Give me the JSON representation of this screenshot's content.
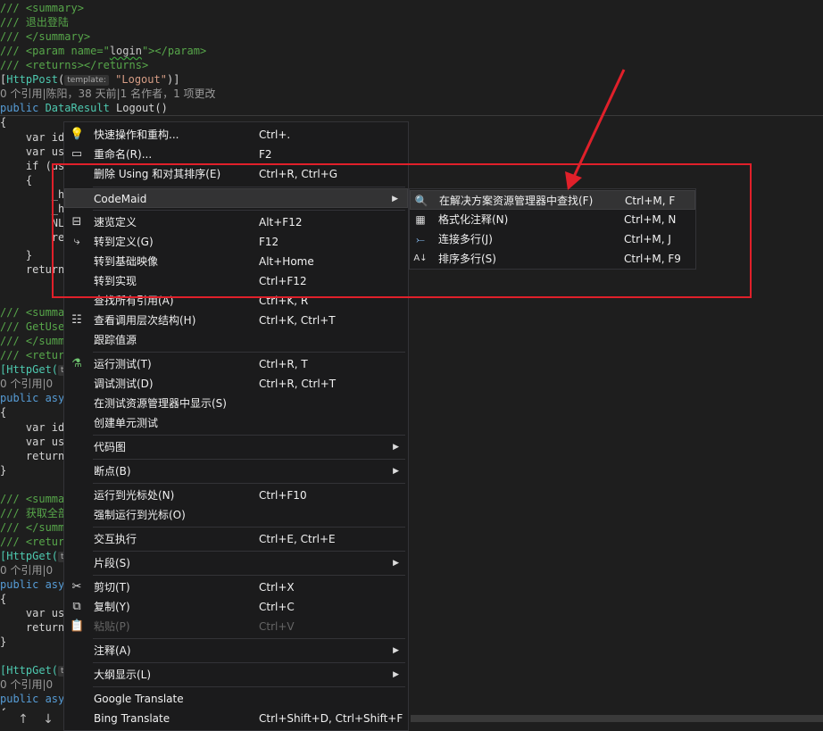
{
  "code": {
    "l1": "/// <summary>",
    "l2": "/// 退出登陆",
    "l3": "/// </summary>",
    "l4a": "/// <param name=\"",
    "l4b": "login",
    "l4c": "\"></param>",
    "l5": "/// <returns></returns>",
    "l6a": "[",
    "l6b": "HttpPost",
    "l6c": "(",
    "l6tmpl": "template:",
    "l6d": " \"Logout\"",
    "l6e": ")]",
    "lens1": "0 个引用|陈阳，38 天前|1 名作者，1 项更改",
    "l7a": "public ",
    "l7b": "DataResult",
    "l7c": " Logout()",
    "l8": "{",
    "l9": "    var id",
    "l10": "    var use",
    "l11": "    if (use",
    "l12": "    {",
    "l13": "        _ht",
    "l14": "        _ht",
    "l15": "        NLo",
    "l16": "        ret",
    "l17": "    }",
    "l18": "    return",
    "l19": "/// <summar",
    "l20": "/// GetUser",
    "l21": "/// </summa",
    "l22": "/// <retur",
    "l23a": "[HttpGet(",
    "l23tmpl": "te",
    "lens2": "0 个引用|0",
    "l24": "public asyn",
    "l25": "{",
    "l26": "    var id",
    "l27": "    var use",
    "l28": "    return",
    "l29": "}",
    "l30": "/// <summar",
    "l31": "/// 获取全部",
    "l32": "/// </summa",
    "l33": "/// <retur",
    "l34a": "[HttpGet(",
    "l34tmpl": "te",
    "lens3": "0 个引用|0",
    "l35": "public asyn",
    "l36": "{",
    "l37": "    var use",
    "l38": "    return",
    "l39": "}",
    "l40a": "[HttpGet(",
    "l40tmpl": "te",
    "lens4": "0 个引用|0",
    "l41": "public asyn",
    "l42": "{"
  },
  "context_menu": {
    "items": [
      {
        "label": "快速操作和重构...",
        "shortcut": "Ctrl+.",
        "icon": "lightbulb-icon"
      },
      {
        "label": "重命名(R)...",
        "shortcut": "F2",
        "icon": "rename-icon"
      },
      {
        "label": "删除 Using 和对其排序(E)",
        "shortcut": "Ctrl+R, Ctrl+G"
      },
      {
        "label": "CodeMaid",
        "shortcut": ""
      },
      {
        "label": "速览定义",
        "shortcut": "Alt+F12",
        "icon": "peek-definition-icon"
      },
      {
        "label": "转到定义(G)",
        "shortcut": "F12",
        "icon": "goto-definition-icon"
      },
      {
        "label": "转到基础映像",
        "shortcut": "Alt+Home"
      },
      {
        "label": "转到实现",
        "shortcut": "Ctrl+F12"
      },
      {
        "label": "查找所有引用(A)",
        "shortcut": "Ctrl+K, R"
      },
      {
        "label": "查看调用层次结构(H)",
        "shortcut": "Ctrl+K, Ctrl+T",
        "icon": "call-hierarchy-icon"
      },
      {
        "label": "跟踪值源",
        "shortcut": ""
      },
      {
        "label": "运行测试(T)",
        "shortcut": "Ctrl+R, T",
        "icon": "run-test-icon"
      },
      {
        "label": "调试测试(D)",
        "shortcut": "Ctrl+R, Ctrl+T"
      },
      {
        "label": "在测试资源管理器中显示(S)",
        "shortcut": ""
      },
      {
        "label": "创建单元测试",
        "shortcut": ""
      },
      {
        "label": "代码图",
        "shortcut": ""
      },
      {
        "label": "断点(B)",
        "shortcut": ""
      },
      {
        "label": "运行到光标处(N)",
        "shortcut": "Ctrl+F10"
      },
      {
        "label": "强制运行到光标(O)",
        "shortcut": ""
      },
      {
        "label": "交互执行",
        "shortcut": "Ctrl+E, Ctrl+E"
      },
      {
        "label": "片段(S)",
        "shortcut": ""
      },
      {
        "label": "剪切(T)",
        "shortcut": "Ctrl+X",
        "icon": "scissors-icon"
      },
      {
        "label": "复制(Y)",
        "shortcut": "Ctrl+C",
        "icon": "copy-icon"
      },
      {
        "label": "粘贴(P)",
        "shortcut": "Ctrl+V",
        "icon": "paste-icon"
      },
      {
        "label": "注释(A)",
        "shortcut": ""
      },
      {
        "label": "大纲显示(L)",
        "shortcut": ""
      },
      {
        "label": "Google Translate",
        "shortcut": ""
      },
      {
        "label": "Bing Translate",
        "shortcut": "Ctrl+Shift+D, Ctrl+Shift+F"
      }
    ]
  },
  "codemaid_submenu": {
    "items": [
      {
        "label": "在解决方案资源管理器中查找(F)",
        "shortcut": "Ctrl+M, F",
        "icon": "find-icon"
      },
      {
        "label": "格式化注释(N)",
        "shortcut": "Ctrl+M, N",
        "icon": "format-comment-icon"
      },
      {
        "label": "连接多行(J)",
        "shortcut": "Ctrl+M, J",
        "icon": "join-lines-icon"
      },
      {
        "label": "排序多行(S)",
        "shortcut": "Ctrl+M, F9",
        "icon": "sort-lines-icon"
      }
    ]
  },
  "status_bar": {
    "up_arrow": "↑",
    "down_arrow": "↓"
  },
  "colors": {
    "annotation_red": "#e0202a",
    "menu_background": "#1b1b1c",
    "comment_green": "#57a64a",
    "keyword_blue": "#569cd6"
  }
}
